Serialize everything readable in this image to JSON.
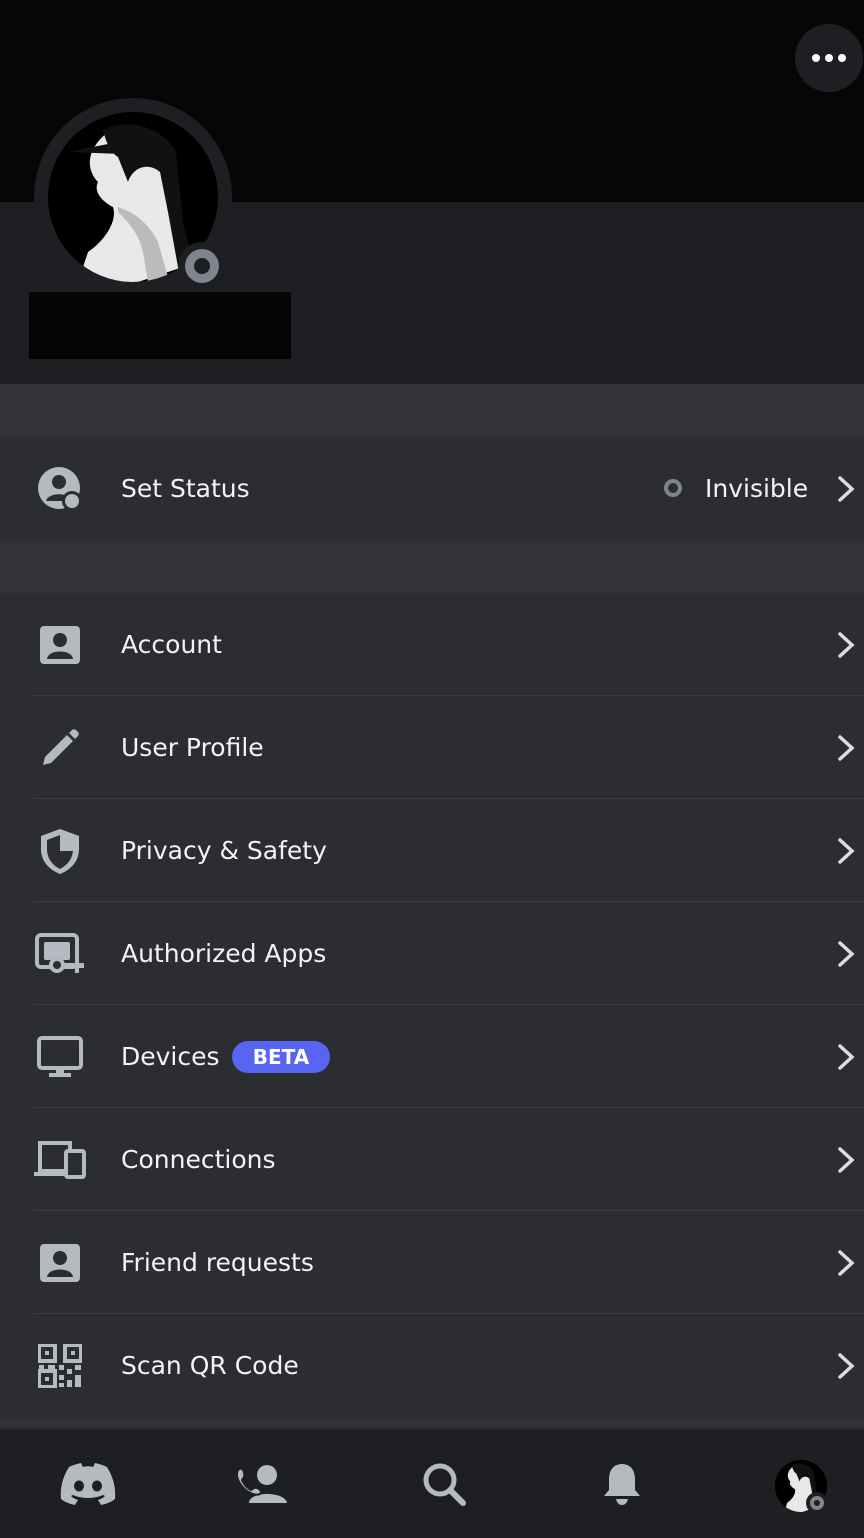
{
  "status_row": {
    "label": "Set Status",
    "value": "Invisible",
    "status_color": "#80848e"
  },
  "menu": [
    {
      "label": "Account",
      "icon": "account-icon"
    },
    {
      "label": "User Profile",
      "icon": "pencil-icon"
    },
    {
      "label": "Privacy & Safety",
      "icon": "shield-icon"
    },
    {
      "label": "Authorized Apps",
      "icon": "authorized-apps-icon"
    },
    {
      "label": "Devices",
      "icon": "monitor-icon",
      "badge": "BETA"
    },
    {
      "label": "Connections",
      "icon": "connections-icon"
    },
    {
      "label": "Friend requests",
      "icon": "friend-requests-icon"
    },
    {
      "label": "Scan QR Code",
      "icon": "qr-code-icon"
    }
  ],
  "tabs": [
    "discord-home-icon",
    "friends-icon",
    "search-icon",
    "notifications-icon",
    "profile-avatar"
  ],
  "colors": {
    "accent": "#5865f2",
    "background": "#2b2d31",
    "header": "#1e1f22",
    "banner": "#060607"
  }
}
